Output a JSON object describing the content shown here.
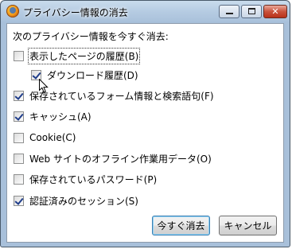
{
  "window": {
    "title": "プライバシー情報の消去",
    "close_glyph": "✕"
  },
  "prompt": "次のプライバシー情報を今すぐ消去:",
  "options": [
    {
      "label": "表示したページの履歴(B)",
      "checked": false
    },
    {
      "label": "ダウンロード履歴(D)",
      "checked": true
    },
    {
      "label": "保存されているフォーム情報と検索語句(F)",
      "checked": true
    },
    {
      "label": "キャッシュ(A)",
      "checked": true
    },
    {
      "label": "Cookie(C)",
      "checked": false
    },
    {
      "label": "Web サイトのオフライン作業用データ(O)",
      "checked": false
    },
    {
      "label": "保存されているパスワード(P)",
      "checked": false
    },
    {
      "label": "認証済みのセッション(S)",
      "checked": true
    }
  ],
  "buttons": {
    "clear_now": "今すぐ消去",
    "cancel": "キャンセル"
  },
  "icons": {
    "app": "firefox-icon",
    "minimize": "minimize-icon",
    "maximize": "maximize-icon",
    "close": "close-icon",
    "cursor": "mouse-pointer-icon"
  }
}
